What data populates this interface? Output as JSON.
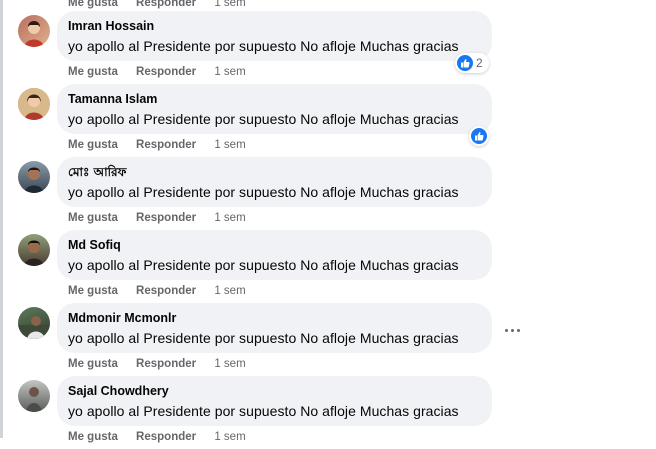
{
  "comments": [
    {
      "author": "Imran Hossain",
      "text": "yo apollo al Presidente por supuesto No afloje Muchas gracias",
      "like_label": "Me gusta",
      "reply_label": "Responder",
      "time": "1 sem",
      "reactions": "2",
      "avatar_colors": [
        "#b76e62",
        "#e2b08a"
      ]
    },
    {
      "author": "Tamanna Islam",
      "text": "yo apollo al Presidente por supuesto No afloje Muchas gracias",
      "like_label": "Me gusta",
      "reply_label": "Responder",
      "time": "1 sem",
      "reactions": "",
      "avatar_colors": [
        "#c94a3a",
        "#e9c49c"
      ]
    },
    {
      "author": "মোঃ আরিফ",
      "text": "yo apollo al Presidente por supuesto No afloje Muchas gracias",
      "like_label": "Me gusta",
      "reply_label": "Responder",
      "time": "1 sem",
      "reactions": "",
      "avatar_colors": [
        "#8a9bab",
        "#3c4650"
      ]
    },
    {
      "author": "Md Sofiq",
      "text": "yo apollo al Presidente por supuesto No afloje Muchas gracias",
      "like_label": "Me gusta",
      "reply_label": "Responder",
      "time": "1 sem",
      "reactions": "",
      "avatar_colors": [
        "#8fa07a",
        "#4a3b30"
      ]
    },
    {
      "author": "Mdmonir Mcmonlr",
      "text": "yo apollo al Presidente por supuesto No afloje Muchas gracias",
      "like_label": "Me gusta",
      "reply_label": "Responder",
      "time": "1 sem",
      "reactions": "",
      "avatar_colors": [
        "#5f7a5a",
        "#2f3b2e"
      ]
    },
    {
      "author": "Sajal Chowdhery",
      "text": "yo apollo al Presidente por supuesto No afloje Muchas gracias",
      "like_label": "Me gusta",
      "reply_label": "Responder",
      "time": "1 sem",
      "reactions": "",
      "avatar_colors": [
        "#a6a8a6",
        "#5a5c5a"
      ]
    }
  ],
  "colors": {
    "bubble": "#f0f2f5",
    "secondary_text": "#65676b",
    "like_blue": "#1877f2"
  }
}
